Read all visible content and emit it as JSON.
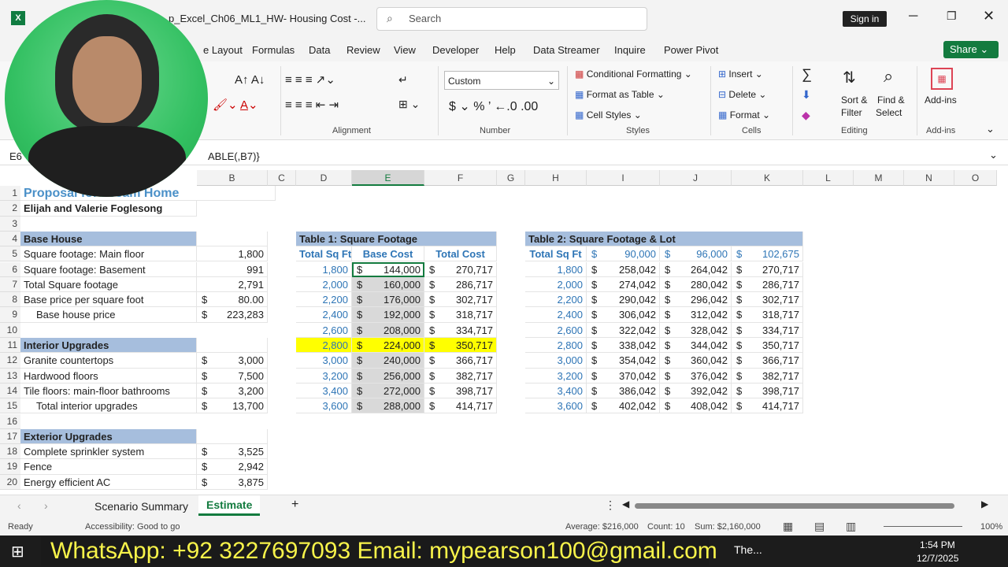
{
  "window": {
    "title": "p_Excel_Ch06_ML1_HW- Housing Cost  -...",
    "search_placeholder": "Search",
    "signin": "Sign in"
  },
  "menu": [
    "e Layout",
    "Formulas",
    "Data",
    "Review",
    "View",
    "Developer",
    "Help",
    "Data Streamer",
    "Inquire",
    "Power Pivot"
  ],
  "share": "Share",
  "ribbon": {
    "number_format": "Custom",
    "conditional_formatting": "Conditional Formatting",
    "format_as_table": "Format as Table",
    "cell_styles": "Cell Styles",
    "insert": "Insert",
    "delete": "Delete",
    "format": "Format",
    "sort_filter": "Sort &",
    "sort_filter2": "Filter",
    "find_select": "Find &",
    "find_select2": "Select",
    "addins": "Add-ins",
    "groups": {
      "alignment": "Alignment",
      "number": "Number",
      "styles": "Styles",
      "cells": "Cells",
      "editing": "Editing",
      "addins": "Add-ins"
    }
  },
  "formula_bar": {
    "name_box": "E6",
    "formula": "ABLE(,B7)}"
  },
  "columns": [
    "B",
    "C",
    "D",
    "E",
    "F",
    "G",
    "H",
    "I",
    "J",
    "K",
    "L",
    "M",
    "N",
    "O"
  ],
  "rows": [
    {
      "n": "1",
      "a": "Proposal for Dream Home"
    },
    {
      "n": "2",
      "a": "Elijah and Valerie Foglesong"
    },
    {
      "n": "3"
    },
    {
      "n": "4",
      "a": "Base House",
      "d": "Table 1: Square Footage",
      "h": "Table 2: Square Footage & Lot"
    },
    {
      "n": "5",
      "a": "Square footage: Main floor",
      "b": "1,800",
      "d": "Total Sq Ft",
      "e": "Base Cost",
      "f": "Total Cost",
      "h": "Total Sq Ft",
      "i": "90,000",
      "j": "96,000",
      "k": "102,675"
    },
    {
      "n": "6",
      "a": "Square footage: Basement",
      "b": "991",
      "d": "1,800",
      "e": "144,000",
      "f": "270,717",
      "h": "1,800",
      "i": "258,042",
      "j": "264,042",
      "k": "270,717"
    },
    {
      "n": "7",
      "a": "Total Square footage",
      "b": "2,791",
      "d": "2,000",
      "e": "160,000",
      "f": "286,717",
      "h": "2,000",
      "i": "274,042",
      "j": "280,042",
      "k": "286,717"
    },
    {
      "n": "8",
      "a": "Base price per square foot",
      "b": "80.00",
      "d": "2,200",
      "e": "176,000",
      "f": "302,717",
      "h": "2,200",
      "i": "290,042",
      "j": "296,042",
      "k": "302,717"
    },
    {
      "n": "9",
      "a": "Base house price",
      "b": "223,283",
      "d": "2,400",
      "e": "192,000",
      "f": "318,717",
      "h": "2,400",
      "i": "306,042",
      "j": "312,042",
      "k": "318,717"
    },
    {
      "n": "10",
      "d": "2,600",
      "e": "208,000",
      "f": "334,717",
      "h": "2,600",
      "i": "322,042",
      "j": "328,042",
      "k": "334,717"
    },
    {
      "n": "11",
      "a": "Interior Upgrades",
      "d": "2,800",
      "e": "224,000",
      "f": "350,717",
      "h": "2,800",
      "i": "338,042",
      "j": "344,042",
      "k": "350,717"
    },
    {
      "n": "12",
      "a": "Granite countertops",
      "b": "3,000",
      "d": "3,000",
      "e": "240,000",
      "f": "366,717",
      "h": "3,000",
      "i": "354,042",
      "j": "360,042",
      "k": "366,717"
    },
    {
      "n": "13",
      "a": "Hardwood floors",
      "b": "7,500",
      "d": "3,200",
      "e": "256,000",
      "f": "382,717",
      "h": "3,200",
      "i": "370,042",
      "j": "376,042",
      "k": "382,717"
    },
    {
      "n": "14",
      "a": "Tile floors: main-floor bathrooms",
      "b": "3,200",
      "d": "3,400",
      "e": "272,000",
      "f": "398,717",
      "h": "3,400",
      "i": "386,042",
      "j": "392,042",
      "k": "398,717"
    },
    {
      "n": "15",
      "a": "Total interior upgrades",
      "b": "13,700",
      "d": "3,600",
      "e": "288,000",
      "f": "414,717",
      "h": "3,600",
      "i": "402,042",
      "j": "408,042",
      "k": "414,717"
    },
    {
      "n": "16"
    },
    {
      "n": "17",
      "a": "Exterior Upgrades"
    },
    {
      "n": "18",
      "a": "Complete sprinkler system",
      "b": "3,525"
    },
    {
      "n": "19",
      "a": "Fence",
      "b": "2,942"
    },
    {
      "n": "20",
      "a": "Energy efficient AC",
      "b": "3,875"
    }
  ],
  "dollar": "$",
  "tabs": {
    "scenario": "Scenario Summary",
    "estimate": "Estimate",
    "add": "+"
  },
  "status": {
    "ready": "Ready",
    "accessibility": "Accessibility: Good to go",
    "average": "Average: $216,000",
    "count": "Count: 10",
    "sum": "Sum: $2,160,000",
    "zoom": "100%"
  },
  "banner": "WhatsApp: +92 3227697093  Email: mypearson100@gmail.com",
  "taskbar": {
    "app": "The...",
    "time": "1:54 PM",
    "date": "12/7/2025"
  },
  "colors": {
    "header_fill": "#a6bedd",
    "yellow": "#ffff00",
    "blue_text": "#2e75b6",
    "selected_fill": "#d9d9d9"
  }
}
